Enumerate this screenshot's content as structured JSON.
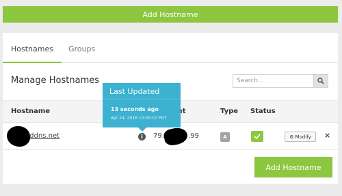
{
  "top_button": {
    "label": "Add Hostname"
  },
  "tabs": [
    {
      "label": "Hostnames",
      "active": true
    },
    {
      "label": "Groups",
      "active": false
    }
  ],
  "manage": {
    "title": "Manage Hostnames"
  },
  "search": {
    "placeholder": "Search...",
    "icon": "search-icon"
  },
  "table": {
    "headers": {
      "hostname": "Hostname",
      "target": "et",
      "type": "Type",
      "status": "Status"
    },
    "rows": [
      {
        "hostname": ".ddns.net",
        "target_start": "79.",
        "target_end": ".99",
        "type": "A",
        "status": "active",
        "modify_label": "Modify",
        "remove_label": "×"
      }
    ]
  },
  "tooltip": {
    "title": "Last Updated",
    "relative": "13 seconds ago",
    "timestamp": "Apr 24, 2016 10:02:07 PDT"
  },
  "bottom_button": {
    "label": "Add Hostname"
  },
  "colors": {
    "accent": "#8dc63f",
    "tooltip": "#3cb1d0"
  }
}
